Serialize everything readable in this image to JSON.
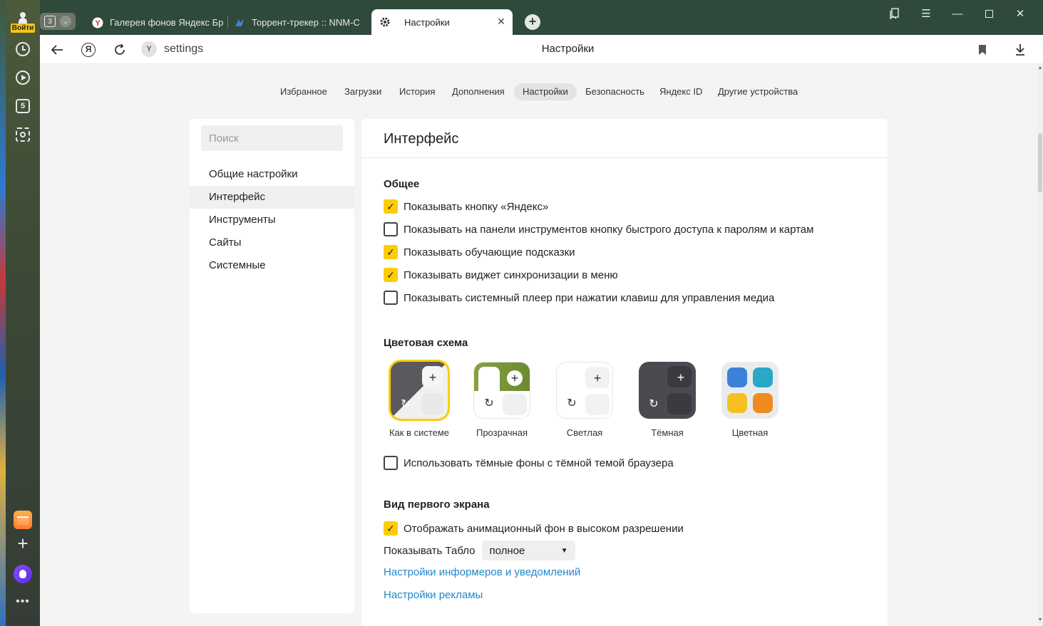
{
  "sidebar": {
    "login_label": "Войти",
    "items": [
      {
        "name": "history",
        "icon": "clock-icon"
      },
      {
        "name": "video",
        "icon": "play-icon"
      },
      {
        "name": "five",
        "icon": "five-icon",
        "text": "5"
      },
      {
        "name": "screenshot",
        "icon": "camera-icon"
      }
    ],
    "more": "•••"
  },
  "tabs": {
    "count": "3",
    "items": [
      {
        "title": "Галерея фонов Яндекс Бр"
      },
      {
        "title": "Торрент-трекер :: NNM-C"
      }
    ],
    "active": {
      "title": "Настройки"
    }
  },
  "toolbar": {
    "address": "settings",
    "page_title": "Настройки"
  },
  "nav": {
    "items": [
      "Избранное",
      "Загрузки",
      "История",
      "Дополнения",
      "Настройки",
      "Безопасность",
      "Яндекс ID",
      "Другие устройства"
    ],
    "active": "Настройки"
  },
  "left_panel": {
    "search_placeholder": "Поиск",
    "items": [
      "Общие настройки",
      "Интерфейс",
      "Инструменты",
      "Сайты",
      "Системные"
    ],
    "active": "Интерфейс"
  },
  "main": {
    "title": "Интерфейс",
    "general": {
      "title": "Общее",
      "options": [
        {
          "label": "Показывать кнопку «Яндекс»",
          "checked": true
        },
        {
          "label": "Показывать на панели инструментов кнопку быстрого доступа к паролям и картам",
          "checked": false
        },
        {
          "label": "Показывать обучающие подсказки",
          "checked": true
        },
        {
          "label": "Показывать виджет синхронизации в меню",
          "checked": true
        },
        {
          "label": "Показывать системный плеер при нажатии клавиш для управления медиа",
          "checked": false
        }
      ]
    },
    "color_scheme": {
      "title": "Цветовая схема",
      "themes": [
        {
          "label": "Как в системе",
          "selected": true
        },
        {
          "label": "Прозрачная",
          "selected": false
        },
        {
          "label": "Светлая",
          "selected": false
        },
        {
          "label": "Тёмная",
          "selected": false
        },
        {
          "label": "Цветная",
          "selected": false
        }
      ],
      "dark_bg_option": {
        "label": "Использовать тёмные фоны с тёмной темой браузера",
        "checked": false
      }
    },
    "first_screen": {
      "title": "Вид первого экрана",
      "anim_option": {
        "label": "Отображать анимационный фон в высоком разрешении",
        "checked": true
      },
      "tablo_label": "Показывать Табло",
      "tablo_value": "полное",
      "link_informers": "Настройки информеров и уведомлений",
      "link_ads": "Настройки рекламы"
    }
  },
  "colors": {
    "accent": "#ffcc00",
    "link": "#1e88c8",
    "titlebar": "#2f4a3a"
  }
}
